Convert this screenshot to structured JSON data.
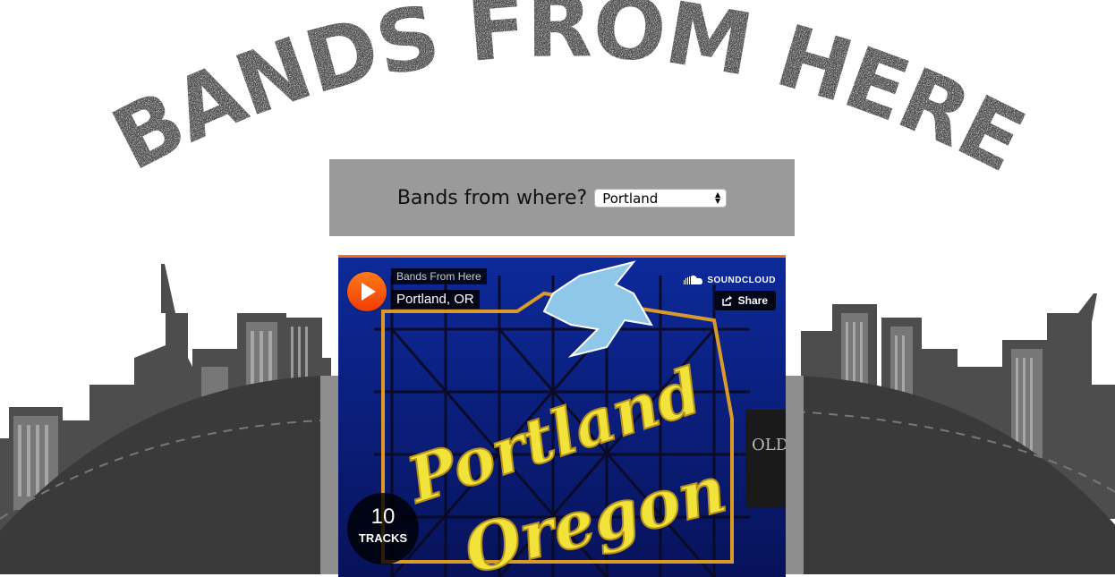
{
  "site": {
    "logo_text": "BANDS FROM HERE"
  },
  "selector": {
    "label": "Bands from where?",
    "selected_city": "Portland"
  },
  "player": {
    "uploader": "Bands From Here",
    "set_title": "Portland, OR",
    "brand": "SOUNDCLOUD",
    "share_label": "Share",
    "track_count": "10",
    "tracks_label": "TRACKS",
    "accent_color": "#f26f23",
    "artwork": {
      "sign_line1": "Portland",
      "sign_line2": "Oregon",
      "side_sign": "OLD TOWN"
    }
  },
  "colors": {
    "logo_gray": "#4a4a4a",
    "bar_gray": "#9a9a9a",
    "ground_dark": "#3a3a3a"
  }
}
